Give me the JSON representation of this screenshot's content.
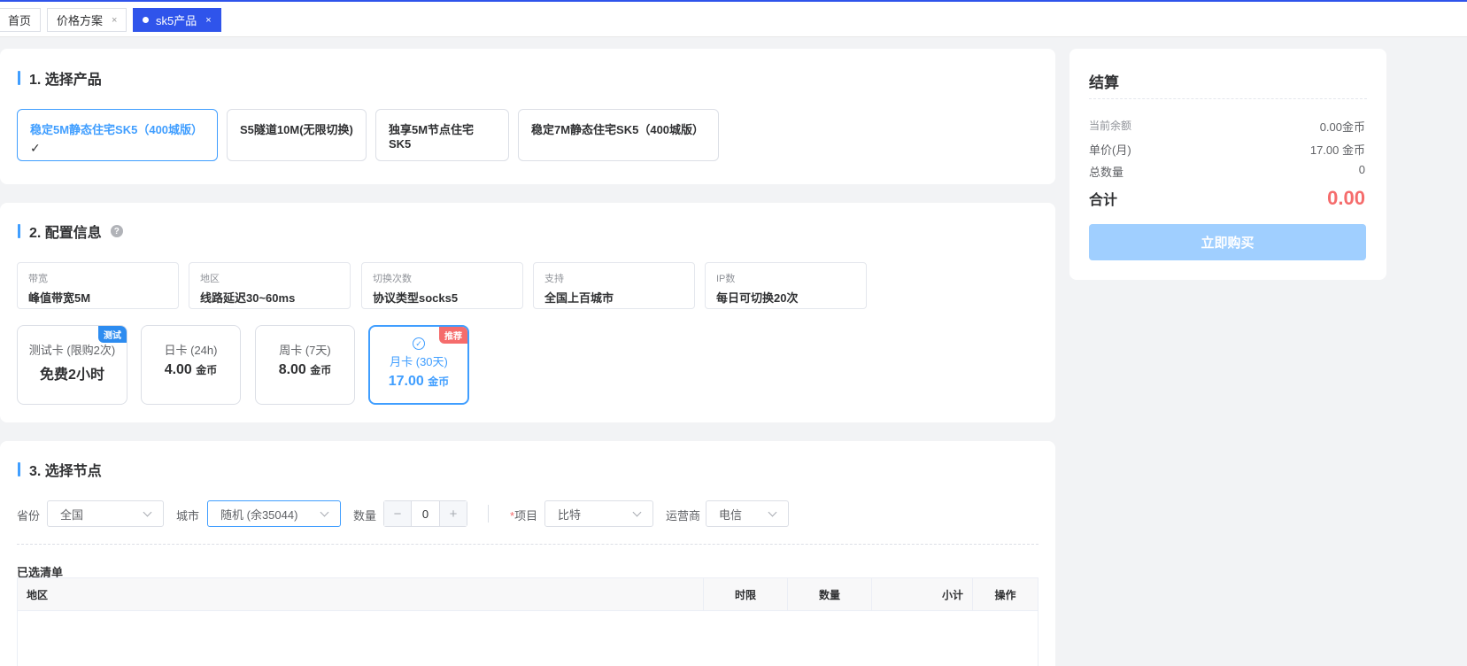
{
  "tabs": [
    {
      "label": "首页"
    },
    {
      "label": "价格方案",
      "close": "×"
    },
    {
      "label": "sk5产品",
      "close": "×"
    }
  ],
  "section1": {
    "title": "1. 选择产品",
    "products": [
      {
        "label": "稳定5M静态住宅SK5（400城版）",
        "selected": true
      },
      {
        "label": "S5隧道10M(无限切换)"
      },
      {
        "label": "独享5M节点住宅SK5"
      },
      {
        "label": "稳定7M静态住宅SK5（400城版）"
      }
    ],
    "check_icon": "✓"
  },
  "section2": {
    "title": "2. 配置信息",
    "help_icon": "?",
    "info": [
      {
        "k": "带宽",
        "v": "峰值带宽5M"
      },
      {
        "k": "地区",
        "v": "线路延迟30~60ms"
      },
      {
        "k": "切换次数",
        "v": "协议类型socks5"
      },
      {
        "k": "支持",
        "v": "全国上百城市"
      },
      {
        "k": "IP数",
        "v": "每日可切换20次"
      }
    ],
    "plans": [
      {
        "name": "测试卡 (限购2次)",
        "price": "免费2小时",
        "unit": "",
        "badge": "测试"
      },
      {
        "name": "日卡 (24h)",
        "price": "4.00",
        "unit": "金币"
      },
      {
        "name": "周卡 (7天)",
        "price": "8.00",
        "unit": "金币"
      },
      {
        "name": "月卡 (30天)",
        "price": "17.00",
        "unit": "金币",
        "badge": "推荐",
        "selected": true
      }
    ]
  },
  "section3": {
    "title": "3. 选择节点",
    "province_label": "省份",
    "province_value": "全国",
    "city_label": "城市",
    "city_value": "随机 (余35044)",
    "qty_label": "数量",
    "qty_minus": "−",
    "qty_value": "0",
    "qty_plus": "+",
    "project_required": "*",
    "project_label": "项目",
    "project_value": "比特",
    "isp_label": "运营商",
    "isp_value": "电信",
    "list_title": "已选清单",
    "columns": [
      "地区",
      "时限",
      "数量",
      "小计",
      "操作"
    ]
  },
  "summary": {
    "title": "结算",
    "rows": [
      {
        "k": "当前余额",
        "v": "0.00金币"
      },
      {
        "k": "单价(月)",
        "v": "17.00 金币"
      },
      {
        "k": "总数量",
        "v": "0"
      }
    ],
    "total_label": "合计",
    "total_value": "0.00",
    "buy_label": "立即购买",
    "colors": {
      "accent": "#409eff",
      "total": "#f56c6c",
      "buy_disabled": "#a0cfff"
    }
  }
}
